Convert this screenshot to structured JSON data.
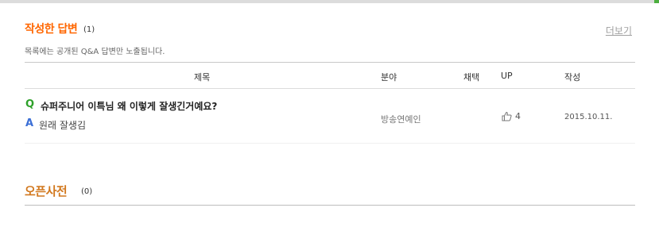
{
  "colors": {
    "accent_orange": "#ff6600",
    "dict_orange": "#d2781e",
    "q_green": "#2ea12a",
    "a_blue": "#3b6fd6"
  },
  "answers_section": {
    "title": "작성한 답변",
    "count": "(1)",
    "more": "더보기",
    "description": "목록에는 공개된 Q&A 답변만 노출됩니다.",
    "columns": {
      "title": "제목",
      "category": "분야",
      "adopted": "채택",
      "up": "UP",
      "date": "작성"
    },
    "rows": [
      {
        "q_mark": "Q",
        "question": "슈퍼주니어 이특님 왜 이렇게 잘생긴거예요?",
        "a_mark": "A",
        "answer": "원래 잘생김",
        "category": "방송연예인",
        "adopted": "",
        "up_icon": "thumbs-up-icon",
        "up_count": "4",
        "date": "2015.10.11."
      }
    ]
  },
  "dict_section": {
    "title": "오픈사전",
    "count": "(0)"
  }
}
